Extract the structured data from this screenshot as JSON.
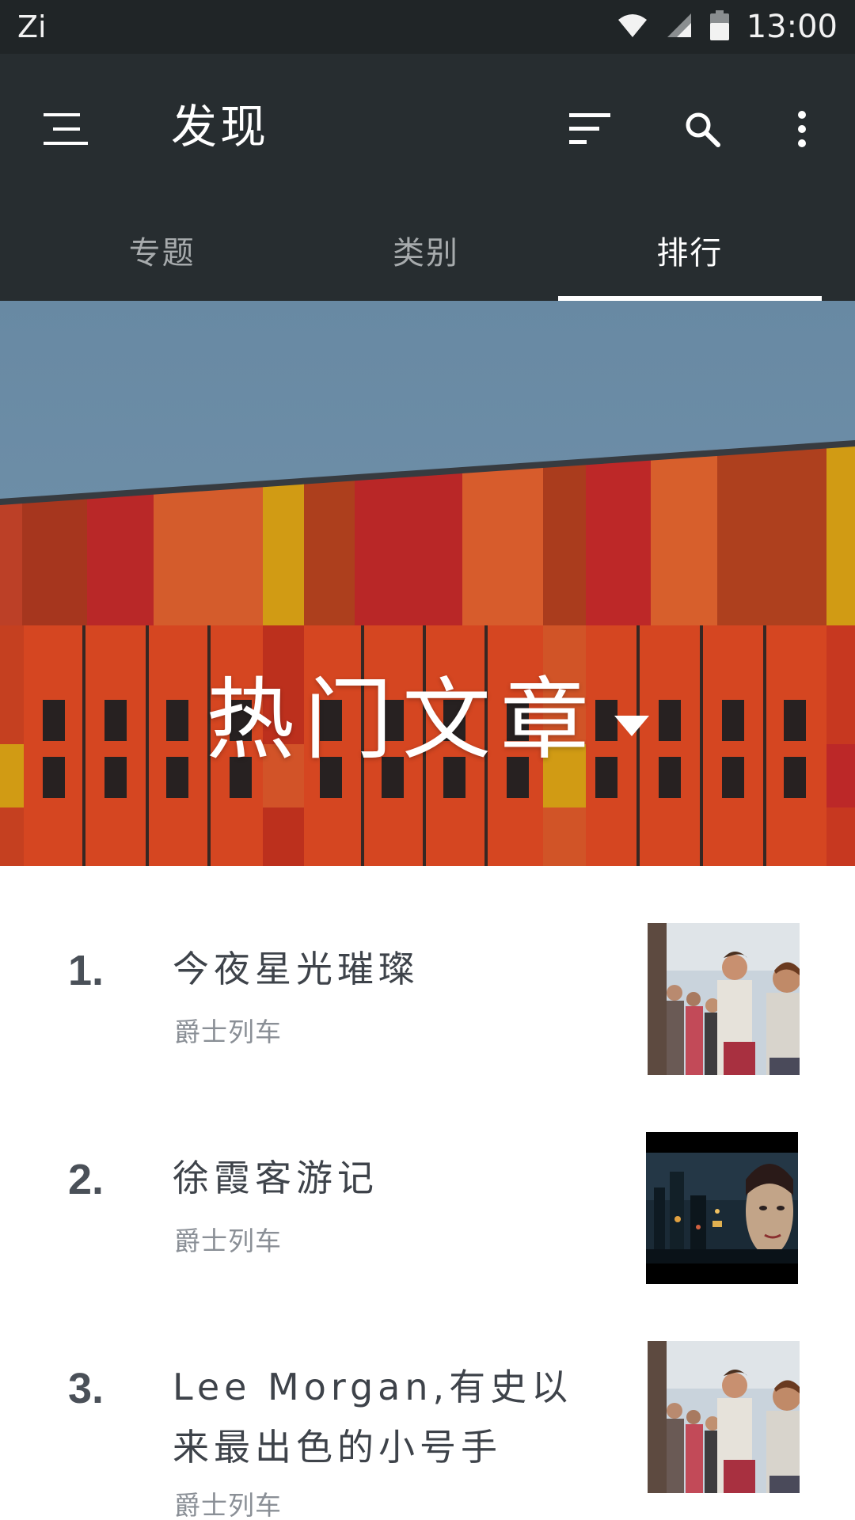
{
  "status_bar": {
    "carrier": "Zi",
    "time": "13:00",
    "icons": [
      "wifi-icon",
      "cell-signal-icon",
      "battery-icon"
    ]
  },
  "app_bar": {
    "title": "发现",
    "icons": [
      "menu-icon",
      "sort-icon",
      "search-icon",
      "more-vert-icon"
    ],
    "tabs": [
      {
        "label": "专题",
        "active": false
      },
      {
        "label": "类别",
        "active": false
      },
      {
        "label": "排行",
        "active": true
      }
    ]
  },
  "hero": {
    "title": "热门文章",
    "dropdown_icon": "caret-down-icon"
  },
  "articles": [
    {
      "rank": "1.",
      "title": "今夜星光璀璨",
      "author": "爵士列车",
      "thumbnail": "crowd-photo"
    },
    {
      "rank": "2.",
      "title": "徐霞客游记",
      "author": "爵士列车",
      "thumbnail": "night-city-photo"
    },
    {
      "rank": "3.",
      "title": "Lee Morgan,有史以来最出色的小号手",
      "author": "爵士列车",
      "thumbnail": "crowd-photo"
    }
  ],
  "colors": {
    "status_bar": "#202527",
    "app_bar": "#272d30",
    "tab_inactive": "#a7abad",
    "tab_active": "#ffffff",
    "rank_text": "#4a5058",
    "title_text": "#3e434a",
    "subtitle_text": "#8a8f96"
  }
}
